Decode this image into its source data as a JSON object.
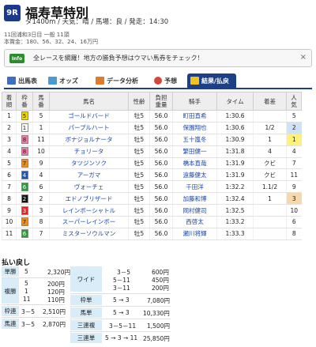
{
  "race": {
    "badge": "9R",
    "title": "福寿草特別",
    "conditions": "ダ1400m / 天気：晴 / 馬場：良 / 発走：14:30",
    "meta": "11回浦和3日目 一般 11頭",
    "prize": "本賞金：180、56、32、24、16万円"
  },
  "banner": {
    "tag": "Info",
    "text": "全レースを網羅！地方の勝負予想はウマい馬券をチェック！",
    "close": "×"
  },
  "tabs": {
    "shutuba": "出馬表",
    "odds": "オッズ",
    "data": "データ分析",
    "yoso": "予想",
    "result": "結果/払戻"
  },
  "table": {
    "headers": {
      "rank": "着\n順",
      "waku": "枠\n番",
      "num": "馬\n番",
      "name": "馬名",
      "sexage": "性齢",
      "weight": "負担\n重量",
      "jockey": "騎手",
      "time": "タイム",
      "margin": "着差",
      "pop": "人\n気"
    },
    "rows": [
      {
        "rank": "1",
        "waku": "5",
        "num": "5",
        "name": "ゴールドバード",
        "sexage": "牡5",
        "weight": "56.0",
        "jockey": "町田直希",
        "time": "1:30.6",
        "margin": "",
        "pop": "5"
      },
      {
        "rank": "2",
        "waku": "1",
        "num": "1",
        "name": "パープルハート",
        "sexage": "牡5",
        "weight": "56.0",
        "jockey": "保園翔也",
        "time": "1:30.6",
        "margin": "1/2",
        "pop": "2"
      },
      {
        "rank": "3",
        "waku": "8",
        "num": "11",
        "name": "ボナジョルナータ",
        "sexage": "牡5",
        "weight": "56.0",
        "jockey": "五十嵐冬",
        "time": "1:30.9",
        "margin": "1",
        "pop": "1"
      },
      {
        "rank": "4",
        "waku": "8",
        "num": "10",
        "name": "チョリータ",
        "sexage": "牡5",
        "weight": "56.0",
        "jockey": "繁田健一",
        "time": "1:31.8",
        "margin": "4",
        "pop": "4"
      },
      {
        "rank": "5",
        "waku": "7",
        "num": "9",
        "name": "タツジンソク",
        "sexage": "牡5",
        "weight": "56.0",
        "jockey": "橋本直哉",
        "time": "1:31.9",
        "margin": "クビ",
        "pop": "7"
      },
      {
        "rank": "6",
        "waku": "4",
        "num": "4",
        "name": "アーガマ",
        "sexage": "牡5",
        "weight": "56.0",
        "jockey": "遠藤健太",
        "time": "1:31.9",
        "margin": "クビ",
        "pop": "11"
      },
      {
        "rank": "7",
        "waku": "6",
        "num": "6",
        "name": "ヴォーチェ",
        "sexage": "牡5",
        "weight": "56.0",
        "jockey": "千田洋",
        "time": "1:32.2",
        "margin": "1.1/2",
        "pop": "9"
      },
      {
        "rank": "8",
        "waku": "2",
        "num": "2",
        "name": "エドノブリザード",
        "sexage": "牡5",
        "weight": "56.0",
        "jockey": "加藤和博",
        "time": "1:32.4",
        "margin": "1",
        "pop": "3"
      },
      {
        "rank": "9",
        "waku": "3",
        "num": "3",
        "name": "レインボーシャトル",
        "sexage": "牡5",
        "weight": "56.0",
        "jockey": "岡村健司",
        "time": "1:32.5",
        "margin": "",
        "pop": "10"
      },
      {
        "rank": "10",
        "waku": "7",
        "num": "8",
        "name": "スーパーレインボー",
        "sexage": "牡5",
        "weight": "56.0",
        "jockey": "西啓太",
        "time": "1:33.2",
        "margin": "",
        "pop": "6"
      },
      {
        "rank": "11",
        "waku": "6",
        "num": "7",
        "name": "ミスターソウルマン",
        "sexage": "牡5",
        "weight": "56.0",
        "jockey": "瀬川将輝",
        "time": "1:33.3",
        "margin": "",
        "pop": "8"
      }
    ]
  },
  "waku_colors": {
    "1": {
      "bg": "#ffffff",
      "fg": "#222222"
    },
    "2": {
      "bg": "#111111",
      "fg": "#ffffff"
    },
    "3": {
      "bg": "#e0262b",
      "fg": "#ffffff"
    },
    "4": {
      "bg": "#1f55b8",
      "fg": "#ffffff"
    },
    "5": {
      "bg": "#f4d20c",
      "fg": "#222222"
    },
    "6": {
      "bg": "#2e9a3c",
      "fg": "#ffffff"
    },
    "7": {
      "bg": "#f08a1c",
      "fg": "#222222"
    },
    "8": {
      "bg": "#ec79a6",
      "fg": "#222222"
    }
  },
  "pop_highlight": {
    "1": "#fff27a",
    "2": "#cfe3f7",
    "3": "#f7d8a8"
  },
  "payouts": {
    "heading": "払い戻し",
    "tansho": {
      "label": "単勝",
      "combo": "5",
      "amount": "2,320円"
    },
    "fukusho": {
      "label": "複勝",
      "combos": [
        "5",
        "1",
        "11"
      ],
      "amounts": [
        "200円",
        "120円",
        "110円"
      ]
    },
    "wakuren": {
      "label": "枠連",
      "combo": "3－5",
      "amount": "2,510円"
    },
    "umaren": {
      "label": "馬連",
      "combo": "3－5",
      "amount": "2,870円"
    },
    "wide": {
      "label": "ワイド",
      "combos": [
        "3－5",
        "5－11",
        "3－11"
      ],
      "amounts": [
        "600円",
        "450円",
        "200円"
      ]
    },
    "wakutan": {
      "label": "枠単",
      "combo": "5 → 3",
      "amount": "7,080円"
    },
    "umatan": {
      "label": "馬単",
      "combo": "5 → 3",
      "amount": "10,330円"
    },
    "sanrenpuku": {
      "label": "三連複",
      "combo": "3－5－11",
      "amount": "1,500円"
    },
    "sanrentan": {
      "label": "三連単",
      "combo": "5 → 3 → 11",
      "amount": "25,850円"
    }
  }
}
